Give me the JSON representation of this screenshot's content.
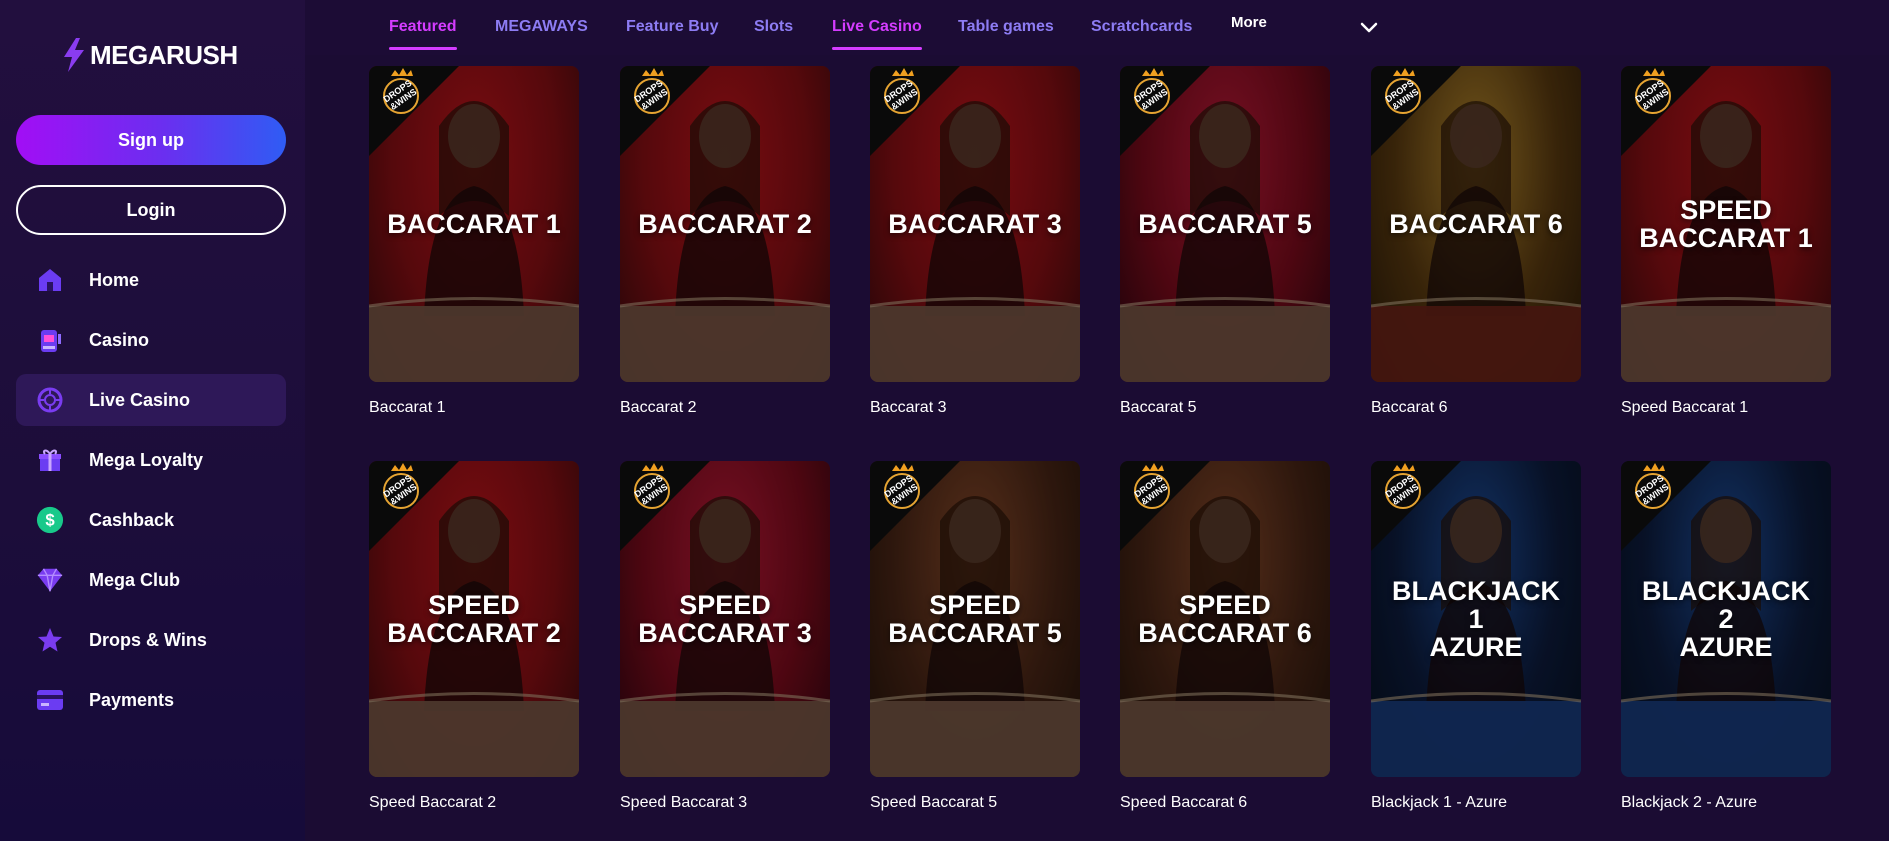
{
  "brand": {
    "name": "MEGARUSH"
  },
  "auth": {
    "signup_label": "Sign up",
    "login_label": "Login"
  },
  "sidebar": {
    "items": [
      {
        "label": "Home",
        "icon": "home-icon"
      },
      {
        "label": "Casino",
        "icon": "slot-machine-icon"
      },
      {
        "label": "Live Casino",
        "icon": "live-casino-icon",
        "active": true
      },
      {
        "label": "Mega Loyalty",
        "icon": "gift-icon"
      },
      {
        "label": "Cashback",
        "icon": "dollar-icon"
      },
      {
        "label": "Mega Club",
        "icon": "diamond-icon"
      },
      {
        "label": "Drops & Wins",
        "icon": "star-icon"
      },
      {
        "label": "Payments",
        "icon": "card-icon"
      }
    ]
  },
  "topnav": {
    "tabs": [
      {
        "label": "Featured",
        "active": true
      },
      {
        "label": "MEGAWAYS"
      },
      {
        "label": "Feature Buy"
      },
      {
        "label": "Slots"
      },
      {
        "label": "Live Casino",
        "active": true
      },
      {
        "label": "Table games"
      },
      {
        "label": "Scratchcards"
      }
    ],
    "more_label": "More"
  },
  "colors": {
    "accent": "#d43cff",
    "tab": "#8d7cf3",
    "background": "#1b0c33"
  },
  "games": [
    {
      "title": "Baccarat 1",
      "art": "BACCARAT 1",
      "theme": "red",
      "badge": "DROPS & WINS"
    },
    {
      "title": "Baccarat 2",
      "art": "BACCARAT 2",
      "theme": "red",
      "badge": "DROPS & WINS"
    },
    {
      "title": "Baccarat 3",
      "art": "BACCARAT 3",
      "theme": "red",
      "badge": "DROPS & WINS"
    },
    {
      "title": "Baccarat 5",
      "art": "BACCARAT 5",
      "theme": "crimson",
      "badge": "DROPS & WINS"
    },
    {
      "title": "Baccarat 6",
      "art": "BACCARAT 6",
      "theme": "gold",
      "badge": "DROPS & WINS"
    },
    {
      "title": "Speed Baccarat 1",
      "art": "SPEED\nBACCARAT 1",
      "theme": "red",
      "badge": "DROPS & WINS"
    },
    {
      "title": "Speed Baccarat 2",
      "art": "SPEED\nBACCARAT 2",
      "theme": "red",
      "badge": "DROPS & WINS"
    },
    {
      "title": "Speed Baccarat 3",
      "art": "SPEED\nBACCARAT 3",
      "theme": "crimson",
      "badge": "DROPS & WINS"
    },
    {
      "title": "Speed Baccarat 5",
      "art": "SPEED\nBACCARAT 5",
      "theme": "brown",
      "badge": "DROPS & WINS"
    },
    {
      "title": "Speed Baccarat 6",
      "art": "SPEED\nBACCARAT 6",
      "theme": "brown",
      "badge": "DROPS & WINS"
    },
    {
      "title": "Blackjack 1 - Azure",
      "art": "BLACKJACK 1\nAZURE",
      "theme": "blue",
      "badge": "DROPS & WINS"
    },
    {
      "title": "Blackjack 2 - Azure",
      "art": "BLACKJACK 2\nAZURE",
      "theme": "blue",
      "badge": "DROPS & WINS"
    }
  ]
}
